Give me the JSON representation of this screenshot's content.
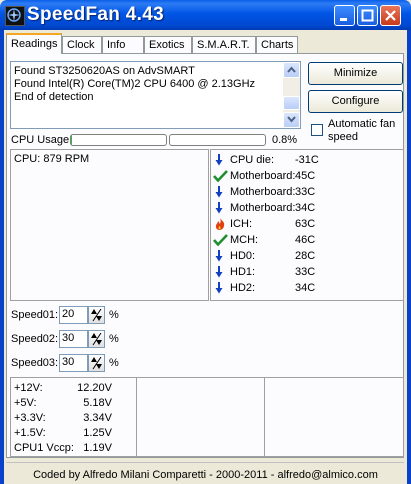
{
  "window": {
    "title": "SpeedFan 4.43"
  },
  "tabs": [
    {
      "label": "Readings",
      "active": true
    },
    {
      "label": "Clock"
    },
    {
      "label": "Info"
    },
    {
      "label": "Exotics"
    },
    {
      "label": "S.M.A.R.T."
    },
    {
      "label": "Charts"
    }
  ],
  "log": {
    "lines": [
      "Found ST3250620AS on AdvSMART",
      "Found Intel(R) Core(TM)2 CPU 6400 @ 2.13GHz",
      "End of detection"
    ]
  },
  "buttons": {
    "minimize": "Minimize",
    "configure": "Configure"
  },
  "auto_fan": {
    "label": "Automatic fan speed",
    "checked": false
  },
  "cpu_usage": {
    "label": "CPU Usage",
    "value": "0.8%",
    "percent": 0.8
  },
  "fans": {
    "text": "CPU: 879 RPM"
  },
  "temps": [
    {
      "name": "CPU die:",
      "value": "-31C",
      "icon": "arrow-down-icon"
    },
    {
      "name": "Motherboard:",
      "value": "45C",
      "icon": "checkmark-icon"
    },
    {
      "name": "Motherboard:",
      "value": "33C",
      "icon": "arrow-down-icon"
    },
    {
      "name": "Motherboard:",
      "value": "34C",
      "icon": "arrow-down-icon"
    },
    {
      "name": "ICH:",
      "value": "63C",
      "icon": "flame-icon"
    },
    {
      "name": "MCH:",
      "value": "46C",
      "icon": "checkmark-icon"
    },
    {
      "name": "HD0:",
      "value": "28C",
      "icon": "arrow-down-icon"
    },
    {
      "name": "HD1:",
      "value": "33C",
      "icon": "arrow-down-icon"
    },
    {
      "name": "HD2:",
      "value": "34C",
      "icon": "arrow-down-icon"
    }
  ],
  "speeds": [
    {
      "label": "Speed01:",
      "value": "20",
      "unit": "%"
    },
    {
      "label": "Speed02:",
      "value": "30",
      "unit": "%"
    },
    {
      "label": "Speed03:",
      "value": "30",
      "unit": "%"
    }
  ],
  "voltages": [
    {
      "name": "+12V:",
      "value": "12.20V"
    },
    {
      "name": "+5V:",
      "value": "5.18V"
    },
    {
      "name": "+3.3V:",
      "value": "3.34V"
    },
    {
      "name": "+1.5V:",
      "value": "1.25V"
    },
    {
      "name": "CPU1 Vccp:",
      "value": "1.19V"
    }
  ],
  "status": {
    "text": "Coded by Alfredo Milani Comparetti - 2000-2011 - alfredo@almico.com"
  },
  "colors": {
    "titlebar": "#0055e5",
    "arrow_blue": "#1040c0",
    "check_green": "#1f8f2f",
    "flame": "#e04010"
  }
}
